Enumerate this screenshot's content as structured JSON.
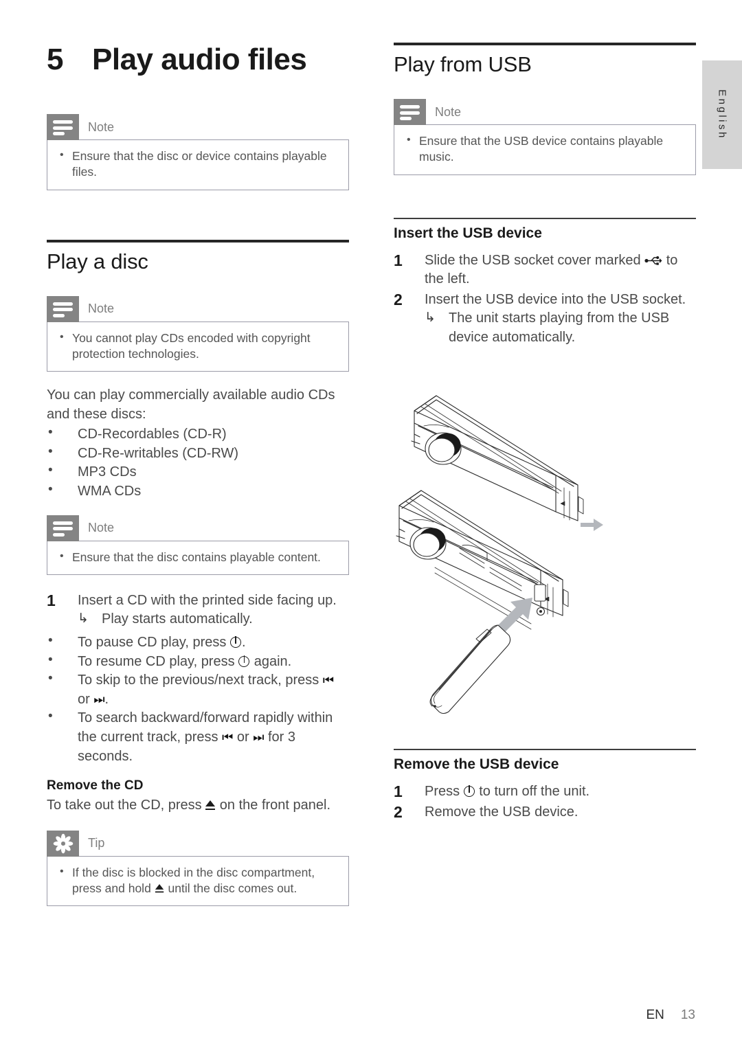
{
  "language_tab": {
    "label": "English"
  },
  "chapter": {
    "number": "5",
    "title": "Play audio files"
  },
  "left_column": {
    "intro_note": {
      "icon": "note-icon",
      "label": "Note",
      "items": [
        "Ensure that the disc or device contains playable files."
      ]
    },
    "play_a_disc": {
      "heading": "Play a disc",
      "note": {
        "icon": "note-icon",
        "label": "Note",
        "items": [
          "You cannot play CDs encoded with copyright protection technologies."
        ]
      },
      "intro": "You can play commercially available audio CDs and these discs:",
      "disc_types": [
        "CD-Recordables (CD-R)",
        "CD-Re-writables (CD-RW)",
        "MP3 CDs",
        "WMA CDs"
      ],
      "note2": {
        "icon": "note-icon",
        "label": "Note",
        "items": [
          "Ensure that the disc contains playable content."
        ]
      },
      "step1": {
        "number": "1",
        "text": "Insert a CD with the printed side facing up.",
        "result_arrow": "↳",
        "result": "Play starts automatically."
      },
      "bullets": [
        {
          "pre": "To pause CD play, press ",
          "icon": "power-icon",
          "post": "."
        },
        {
          "pre": "To resume CD play, press ",
          "icon": "power-icon",
          "post": " again."
        },
        {
          "pre": "To skip to the previous/next track, press ",
          "icon": "prev-next-icon",
          "post": "."
        },
        {
          "pre": "To search backward/forward rapidly within the current track, press ",
          "icon": "prev-next-icon",
          "post": " for 3 seconds."
        }
      ],
      "bullet_track_icons": {
        "prev": "⏮",
        "sep": " or ",
        "next": "⏭"
      }
    },
    "remove_the_cd": {
      "heading": "Remove the CD",
      "pre": "To take out the CD, press ",
      "icon": "eject-icon",
      "post": " on the front panel.",
      "tip": {
        "icon": "tip-icon",
        "label": "Tip",
        "pre": "If the disc is blocked in the disc compartment, press and hold ",
        "icon_inline": "eject-icon",
        "post": " until the disc comes out."
      }
    }
  },
  "right_column": {
    "play_from_usb": {
      "heading": "Play from USB",
      "note": {
        "icon": "note-icon",
        "label": "Note",
        "items": [
          "Ensure that the USB device contains playable music."
        ]
      }
    },
    "insert_usb": {
      "heading": "Insert the USB device",
      "step1": {
        "number": "1",
        "pre": "Slide the USB socket cover marked ",
        "icon": "usb-icon",
        "post": " to the left."
      },
      "step2": {
        "number": "2",
        "text": "Insert the USB device into the USB socket.",
        "result_arrow": "↳",
        "result": "The unit starts playing from the USB device automatically."
      }
    },
    "illustration": {
      "name": "car-stereo-usb-insert-illustration",
      "description": "Line drawing of a car audio faceplate with USB cover slide arrow and a USB flash drive being inserted"
    },
    "remove_usb": {
      "heading": "Remove the USB device",
      "step1": {
        "number": "1",
        "pre": "Press ",
        "icon": "power-icon",
        "post": " to turn off the unit."
      },
      "step2": {
        "number": "2",
        "text": "Remove the USB device."
      }
    }
  },
  "footer": {
    "language_code": "EN",
    "page_number": "13"
  },
  "colors": {
    "callout_icon_bg": "#848484",
    "callout_label": "#7e7e7e",
    "callout_border": "#9b9ba8",
    "rule_dark": "#262626",
    "lang_tab_bg": "#d4d4d4",
    "body_text": "#4a4a4a",
    "heading_text": "#1a1a1a"
  }
}
